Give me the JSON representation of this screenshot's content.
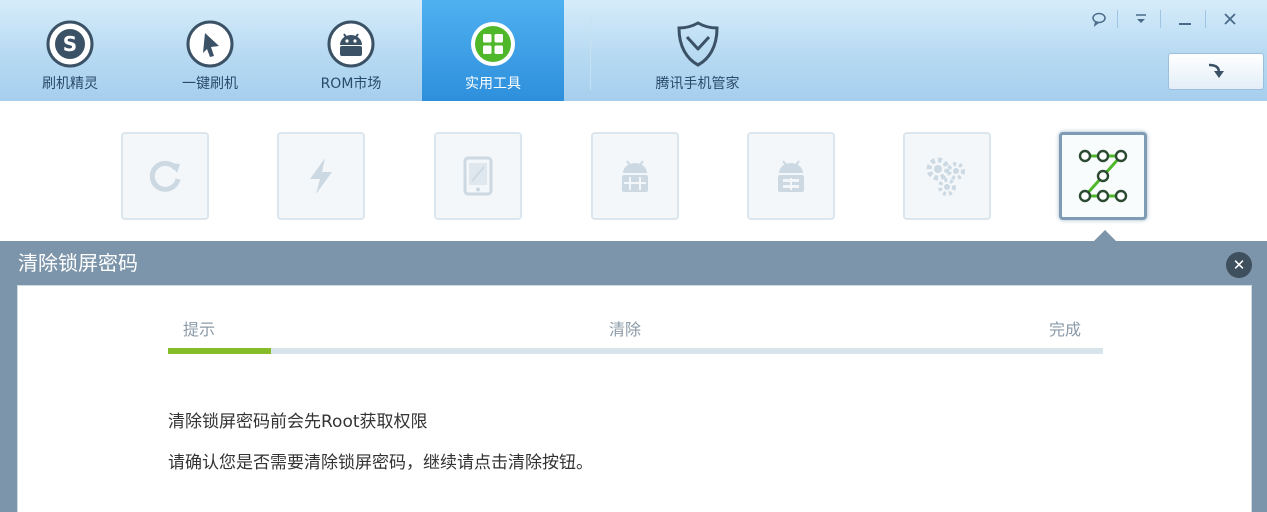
{
  "nav": {
    "tabs": [
      {
        "label": "刷机精灵",
        "icon": "shuajijingling-logo-icon"
      },
      {
        "label": "一键刷机",
        "icon": "one-click-flash-icon"
      },
      {
        "label": "ROM市场",
        "icon": "android-rom-icon"
      },
      {
        "label": "实用工具",
        "icon": "grid-tools-icon",
        "active": true
      },
      {
        "label": "腾讯手机管家",
        "icon": "shield-heart-icon"
      }
    ]
  },
  "window_controls": [
    "feedback-icon",
    "menu-icon",
    "minimize-icon",
    "close-icon"
  ],
  "tools": [
    {
      "icon": "refresh-icon"
    },
    {
      "icon": "lightning-icon"
    },
    {
      "icon": "tablet-icon"
    },
    {
      "icon": "android-package-icon"
    },
    {
      "icon": "android-backup-icon"
    },
    {
      "icon": "gears-icon"
    },
    {
      "icon": "pattern-lock-icon",
      "active": true
    }
  ],
  "dialog": {
    "title": "清除锁屏密码",
    "close_glyph": "✕",
    "steps": [
      "提示",
      "清除",
      "完成"
    ],
    "progress": 0.11,
    "messages": [
      "清除锁屏密码前会先Root获取权限",
      "请确认您是否需要清除锁屏密码，继续请点击清除按钮。"
    ]
  },
  "colors": {
    "nav_active": "#3a9be4",
    "progress": "#86bc2a",
    "dialog_header": "#7c95aa"
  }
}
